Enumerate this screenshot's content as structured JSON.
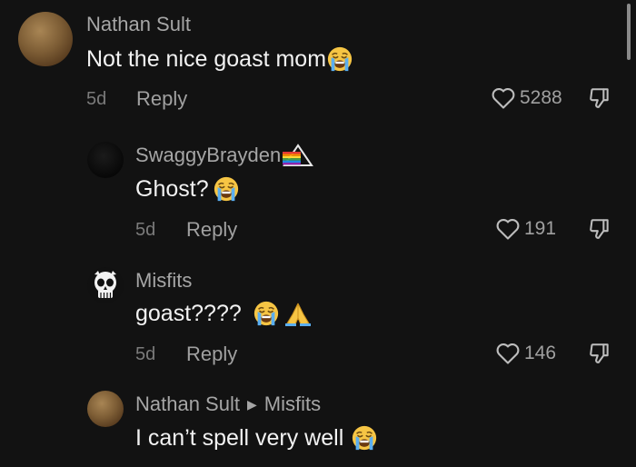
{
  "comments": [
    {
      "username": "Nathan Sult",
      "text": "Not the nice goast mom",
      "time": "5d",
      "reply_label": "Reply",
      "likes": "5288",
      "avatar": "brown-texture-avatar"
    },
    {
      "username": "SwaggyBrayden",
      "text": "Ghost?",
      "time": "5d",
      "reply_label": "Reply",
      "likes": "191",
      "avatar": "dark-avatar"
    },
    {
      "username": "Misfits",
      "text": "goast????",
      "time": "5d",
      "reply_label": "Reply",
      "likes": "146",
      "avatar": "skull-avatar"
    },
    {
      "username": "Nathan Sult",
      "reply_to": "Misfits",
      "text": "I can’t spell very well",
      "avatar": "brown-texture-avatar"
    }
  ],
  "colors": {
    "background": "#121212",
    "username": "#a6a6a6",
    "text": "#f2f2f2",
    "meta": "#7b7b7b"
  },
  "icons": [
    "crying-emoji-icon",
    "rainbow-prism-icon",
    "praying-hands-emoji-icon",
    "heart-outline-icon",
    "thumbs-down-icon",
    "chevron-right-icon"
  ]
}
